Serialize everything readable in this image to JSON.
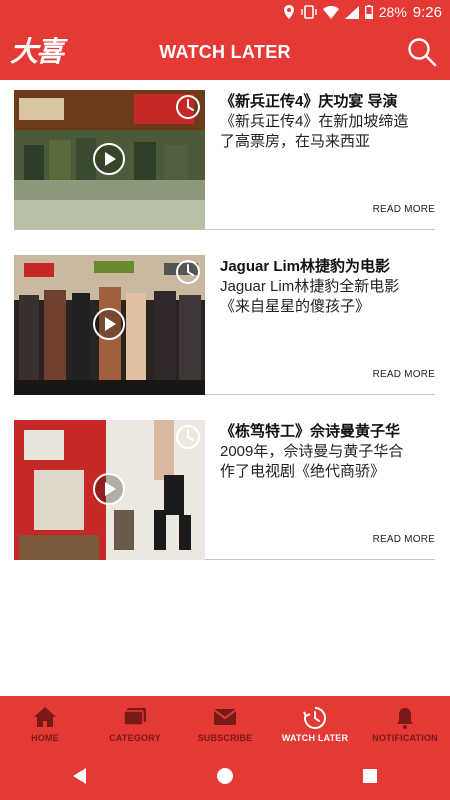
{
  "status": {
    "battery": "28%",
    "time": "9:26"
  },
  "app": {
    "logo": "大喜",
    "title": "WATCH LATER"
  },
  "cards": [
    {
      "title": "《新兵正传4》庆功宴 导演",
      "desc": "《新兵正传4》在新加坡缔造了高票房，在马来西亚",
      "read_more": "READ MORE"
    },
    {
      "title": "Jaguar Lim林捷豹为电影",
      "desc": "Jaguar Lim林捷豹全新电影《来自星星的傻孩子》",
      "read_more": "READ MORE"
    },
    {
      "title": "《栋笃特工》佘诗曼黄子华",
      "desc": "2009年，佘诗曼与黄子华合作了电视剧《绝代商骄》",
      "read_more": "READ MORE"
    }
  ],
  "nav": [
    {
      "label": "HOME",
      "icon": "home-icon"
    },
    {
      "label": "CATEGORY",
      "icon": "category-icon"
    },
    {
      "label": "SUBSCRIBE",
      "icon": "mail-icon"
    },
    {
      "label": "WATCH LATER",
      "icon": "clock-icon"
    },
    {
      "label": "NOTIFICATION",
      "icon": "bell-icon"
    }
  ],
  "colors": {
    "primary": "#e53935",
    "nav_inactive": "#7a1a17",
    "nav_active": "#ffffff"
  }
}
